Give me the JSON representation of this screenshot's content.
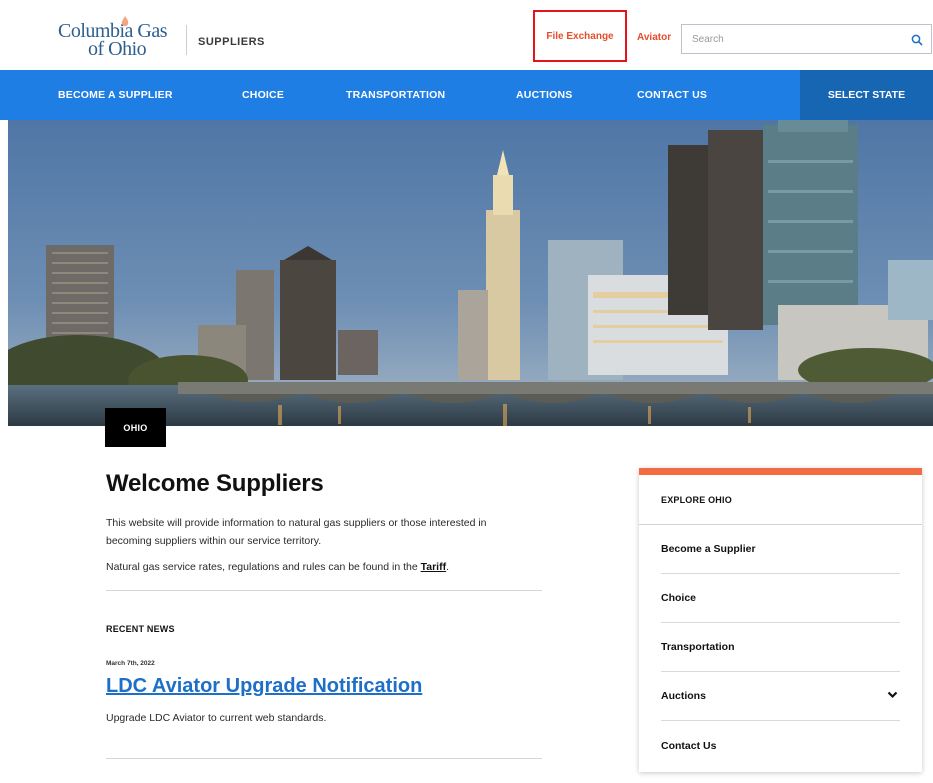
{
  "header": {
    "logo_line1": "Columbia Gas",
    "logo_line2": "of Ohio",
    "site_label": "SUPPLIERS",
    "file_exchange": "File Exchange",
    "aviator": "Aviator",
    "search_placeholder": "Search",
    "search_icon": "magnifier-icon"
  },
  "nav": {
    "items": [
      "BECOME A SUPPLIER",
      "CHOICE",
      "TRANSPORTATION",
      "AUCTIONS",
      "CONTACT US"
    ],
    "select_state": "SELECT STATE"
  },
  "hero": {
    "tag": "OHIO"
  },
  "main": {
    "title": "Welcome Suppliers",
    "intro": "This website will provide information to natural gas suppliers or those interested in becoming suppliers within our service territory.",
    "rates_text": "Natural gas service rates, regulations and rules can be found in the ",
    "tariff_link": "Tariff",
    "rates_end": ".",
    "recent_news_heading": "RECENT NEWS",
    "news": {
      "date": "March 7th, 2022",
      "title": "LDC Aviator Upgrade Notification",
      "description": "Upgrade LDC Aviator to current web standards."
    }
  },
  "sidebar": {
    "heading": "EXPLORE OHIO",
    "items": [
      "Become a Supplier",
      "Choice",
      "Transportation",
      "Auctions",
      "Contact Us"
    ],
    "accent_color": "#f26b43"
  },
  "colors": {
    "nav_blue": "#1e7ee3",
    "nav_dark": "#1766b4",
    "link_orange": "#e64e2a",
    "highlight_red": "#e3151a",
    "news_link_blue": "#1e6fc7"
  }
}
